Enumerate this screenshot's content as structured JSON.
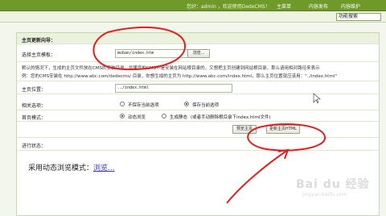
{
  "topbar": {
    "greeting": "您好：admin ，欢迎使用DedeCMS！",
    "nav": [
      "主菜单",
      "内容发布",
      "内容维护"
    ]
  },
  "subbar": {
    "menu_select": "功能搜索"
  },
  "form": {
    "section_title": "主页更新向导：",
    "template": {
      "label": "选择主页模板：",
      "value": "moban/index.htm",
      "browse_label": "浏览..."
    },
    "notice_line1": "默认的情况下，生成的主页文件放在CMS的安装目录，如果您的CMS不是安装在网站根目录的，又想把主页创建到网站根目录，那么请用相对路径来表示",
    "notice_line2": "例：您的CMS安装在 http://www.abc.com/dedecms/ 目录，你想生成的主页为 http://www.abc.com/index.html，那么主页位置就应该用：\"../index.html\"",
    "position": {
      "label": "主页位置：",
      "value": "../index.html"
    },
    "related": {
      "label": "相关选项：",
      "options": [
        "不保存当前选项",
        "保存当前选项"
      ],
      "selected": 1
    },
    "mode": {
      "label": "首页模式：",
      "options": [
        "动态浏览",
        "生成静态"
      ],
      "selected": 0,
      "hint": "(或者手动删除根目录下index.html文件)"
    },
    "preview_label": "预览主页",
    "update_label": "更新主页HTML",
    "status": {
      "label": "进行状态：",
      "text": "采用动态浏览模式：",
      "link": "浏览..."
    }
  },
  "watermark": {
    "main": "Bai du 经验",
    "sub": "jingyan.baidu.com"
  },
  "colors": {
    "topbar": "#6f9a2a",
    "panel_header": "#eaf1dc",
    "annotation": "#e0201e",
    "link": "#3a3aa8"
  }
}
